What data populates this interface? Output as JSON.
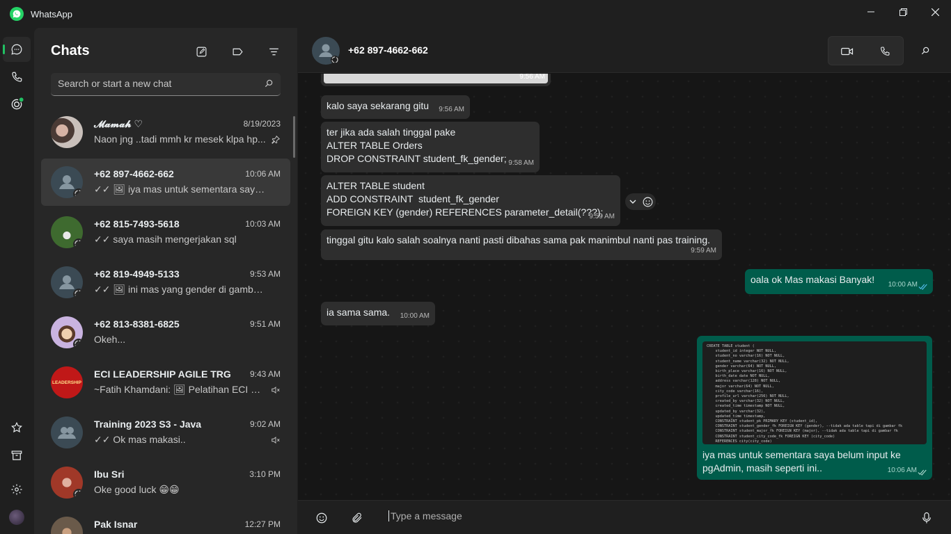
{
  "app": {
    "title": "WhatsApp"
  },
  "window_controls": {
    "minimize": "—",
    "maximize": "❐",
    "close": "✕"
  },
  "sidebar": {
    "title": "Chats",
    "search_placeholder": "Search or start a new chat",
    "chats": [
      {
        "name": "𝓜𝓪𝓶𝓪𝓱 ♡",
        "time": "8/19/2023",
        "preview": "Naon jng ..tadi mmh kr mesek klpa hp...",
        "trail": "pin-icon",
        "avatar_color": "#7a5c58"
      },
      {
        "name": "+62 897-4662-662",
        "time": "10:06 AM",
        "preview": "✓✓ 🖼 iya mas untuk sementara saya b...",
        "trail": "",
        "avatar_color": "#3b4a54"
      },
      {
        "name": "+62 815-7493-5618",
        "time": "10:03 AM",
        "preview": "✓✓ saya masih mengerjakan sql",
        "trail": "",
        "avatar_color": "#3e5a2f"
      },
      {
        "name": "+62 819-4949-5133",
        "time": "9:53 AM",
        "preview": "✓✓ 🖼 ini mas yang gender di gambar...",
        "trail": "",
        "avatar_color": "#3b4a54"
      },
      {
        "name": "+62 813-8381-6825",
        "time": "9:51 AM",
        "preview": "Okeh...",
        "trail": "",
        "avatar_color": "#b7a3c9"
      },
      {
        "name": "ECI LEADERSHIP AGILE TRG",
        "time": "9:43 AM",
        "preview": "~Fatih Khamdani: 🖼 Pelatihan ECI ma...",
        "trail": "mute-icon",
        "avatar_color": "#c01818",
        "avatar_text": "LEADERSHIP"
      },
      {
        "name": "Training 2023 S3 - Java",
        "time": "9:02 AM",
        "preview": "✓✓ Ok mas makasi..",
        "trail": "mute-icon",
        "avatar_color": "#3b4a54"
      },
      {
        "name": "Ibu Sri",
        "time": "3:10 PM",
        "preview": "Oke good luck 😁😁",
        "trail": "",
        "avatar_color": "#a04030"
      },
      {
        "name": "Pak Isnar",
        "time": "12:27 PM",
        "preview": "",
        "trail": "",
        "avatar_color": "#6a5a4a"
      }
    ]
  },
  "conversation": {
    "contact": "+62 897-4662-662",
    "composer_placeholder": "Type a message",
    "messages": [
      {
        "dir": "in",
        "text": "",
        "time": "9:56 AM",
        "kind": "image-tail"
      },
      {
        "dir": "in",
        "text": "kalo saya sekarang gitu",
        "time": "9:56 AM"
      },
      {
        "dir": "in",
        "text": "ter jika ada salah tinggal pake\nALTER TABLE Orders\nDROP CONSTRAINT student_fk_gender;",
        "time": "9:58 AM"
      },
      {
        "dir": "in",
        "text": "ALTER TABLE student\nADD CONSTRAINT  student_fk_gender\nFOREIGN KEY (gender) REFERENCES parameter_detail(???);",
        "time": "9:59 AM"
      },
      {
        "dir": "in",
        "text": "tinggal gitu kalo salah soalnya nanti pasti dibahas sama pak manimbul nanti pas training.",
        "time": "9:59 AM"
      },
      {
        "dir": "out",
        "text": "oala ok Mas makasi Banyak!",
        "time": "10:00 AM"
      },
      {
        "dir": "in",
        "text": "ia sama sama.",
        "time": "10:00 AM"
      },
      {
        "dir": "out",
        "text": "iya mas untuk sementara saya belum input ke\npgAdmin, masih seperti ini..",
        "time": "10:06 AM",
        "kind": "image"
      }
    ],
    "code_image_lines": [
      "CREATE TABLE student (",
      "    student_id integer NOT NULL,",
      "    student_no varchar(16) NOT NULL,",
      "    student_name varchar(32) NOT NULL,",
      "    gender varchar(64) NOT NULL,",
      "    birth_place varchar(16) NOT NULL,",
      "    birth_date date NOT NULL,",
      "    address varchar(128) NOT NULL,",
      "    major varchar(64) NOT NULL,",
      "    city_code varchar(16),",
      "    profile_url varchar(256) NOT NULL,",
      "    created_by varchar(32) NOT NULL,",
      "    created_time timestamp NOT NULL,",
      "    updated_by varchar(32),",
      "    updated_time timestamp,",
      "    CONSTRAINT student_pk PRIMARY KEY (student_id),",
      "    CONSTRAINT student_gender_fk FOREIGN KEY (gender), --tidak ada table tapi di gambar fk",
      "    CONSTRAINT student_major_fk FOREIGN KEY (major), --tidak ada table tapi di gambar fk",
      "    CONSTRAINT student_city_code_fk FOREIGN KEY (city_code)",
      "    REFERENCES city(city_code)"
    ]
  },
  "colors": {
    "accent": "#21c063",
    "outgoing": "#005c4b",
    "incoming": "#2e2e2e",
    "read_tick": "#53bdeb"
  }
}
